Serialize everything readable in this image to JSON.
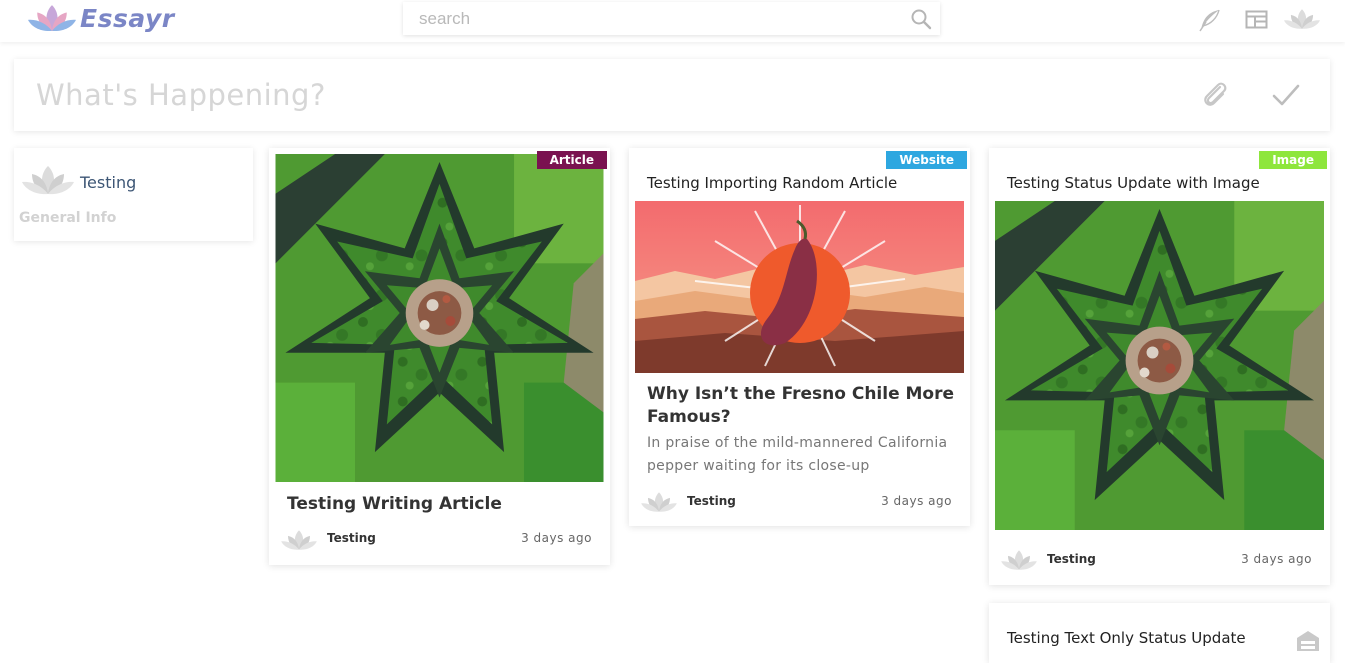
{
  "app": {
    "logo_text": "Essayr",
    "logo_icon": "lotus-logo-icon"
  },
  "header": {
    "search_placeholder": "search",
    "icons": [
      "feather-icon",
      "layout-icon",
      "lotus-avatar-icon"
    ]
  },
  "composer": {
    "placeholder": "What's Happening?",
    "icons": [
      "paperclip-icon",
      "checkmark-icon"
    ]
  },
  "profile": {
    "name": "Testing",
    "info_link": "General Info"
  },
  "colors": {
    "accent": "#7b86c6",
    "article_badge": "#7a1250",
    "website_badge": "#2ea7e0",
    "image_badge": "#8ee63c"
  },
  "posts": [
    {
      "badge": "Article",
      "headline": "Testing Writing Article",
      "author": "Testing",
      "time": "3 days ago"
    },
    {
      "badge": "Website",
      "title": "Testing Importing Random Article",
      "headline": "Why Isn’t the Fresno Chile More Famous?",
      "excerpt": "In praise of the mild-mannered California pepper waiting for its close-up",
      "author": "Testing",
      "time": "3 days ago"
    },
    {
      "badge": "Image",
      "title": "Testing Status Update with Image",
      "author": "Testing",
      "time": "3 days ago"
    },
    {
      "title": "Testing Text Only Status Update"
    }
  ]
}
